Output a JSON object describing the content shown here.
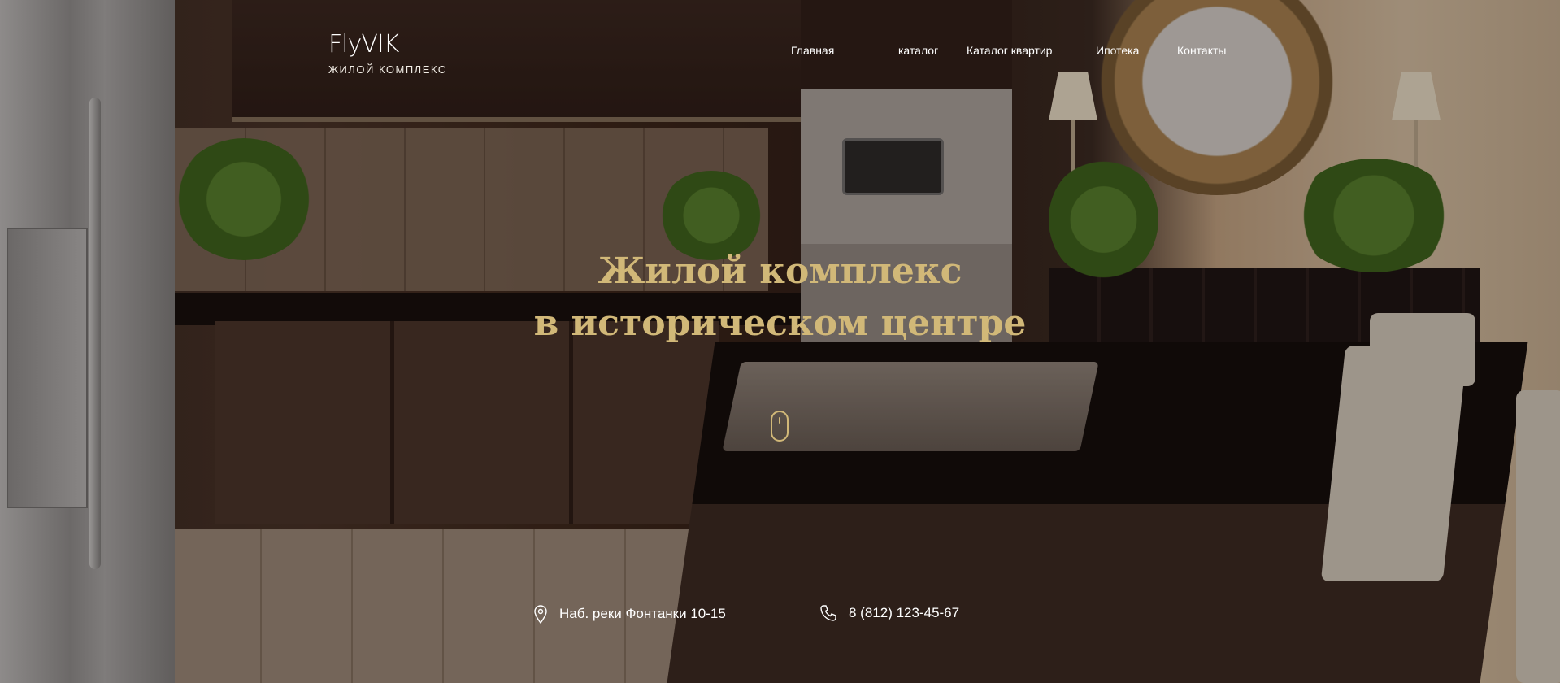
{
  "brand": {
    "name": "FlyVIK",
    "tagline": "ЖИЛОЙ КОМПЛЕКС"
  },
  "nav": {
    "items": [
      {
        "label": "Главная"
      },
      {
        "label": "каталог"
      },
      {
        "label": "Каталог квартир"
      },
      {
        "label": "Ипотека"
      },
      {
        "label": "Контакты"
      }
    ]
  },
  "hero": {
    "title_line1": "Жилой комплекс",
    "title_line2": "в историческом центре"
  },
  "contacts": {
    "address": "Наб. реки Фонтанки 10-15",
    "phone": "8 (812) 123-45-67"
  },
  "colors": {
    "accent_gold": "#d1b878",
    "text_white": "#ffffff"
  },
  "icons": {
    "location": "location-pin-icon",
    "phone": "phone-icon",
    "scroll": "mouse-scroll-icon"
  }
}
